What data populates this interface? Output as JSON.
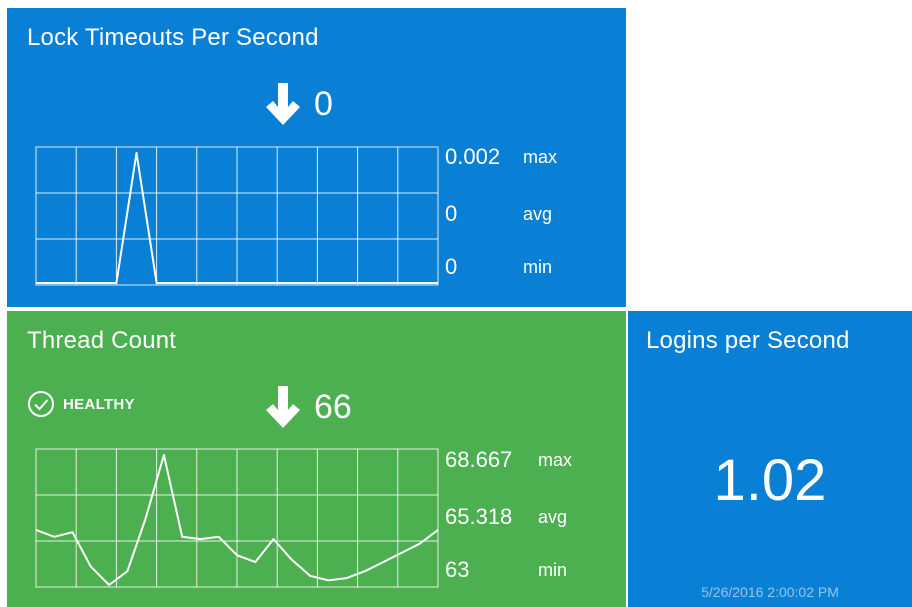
{
  "colors": {
    "blue": "#0a7fd6",
    "green": "#4caf50",
    "white": "#ffffff"
  },
  "lock_tile": {
    "title": "Lock Timeouts Per Second",
    "trend_icon": "arrow-down-icon",
    "current_value": "0",
    "max_value": "0.002",
    "max_label": "max",
    "avg_value": "0",
    "avg_label": "avg",
    "min_value": "0",
    "min_label": "min"
  },
  "thread_tile": {
    "title": "Thread Count",
    "status_icon": "check-circle-icon",
    "status": "HEALTHY",
    "trend_icon": "arrow-down-icon",
    "current_value": "66",
    "max_value": "68.667",
    "max_label": "max",
    "avg_value": "65.318",
    "avg_label": "avg",
    "min_value": "63",
    "min_label": "min"
  },
  "logins_tile": {
    "title": "Logins per Second",
    "value": "1.02",
    "timestamp": "5/26/2016 2:00:02 PM"
  },
  "chart_data": [
    {
      "type": "line",
      "name": "lock-timeouts",
      "ylim": [
        0,
        0.002
      ],
      "grid": true,
      "x": [
        0,
        1,
        2,
        3,
        4,
        5,
        6,
        7,
        8,
        9,
        10,
        11,
        12,
        13,
        14,
        15,
        16,
        17,
        18,
        19,
        20
      ],
      "values": [
        0,
        0,
        0,
        0,
        0,
        0.002,
        0,
        0,
        0,
        0,
        0,
        0,
        0,
        0,
        0,
        0,
        0,
        0,
        0,
        0,
        0
      ]
    },
    {
      "type": "line",
      "name": "thread-count",
      "ylim": [
        63,
        68.667
      ],
      "grid": true,
      "x": [
        0,
        1,
        2,
        3,
        4,
        5,
        6,
        7,
        8,
        9,
        10,
        11,
        12,
        13,
        14,
        15,
        16,
        17,
        18,
        19,
        20,
        21,
        22
      ],
      "values": [
        65.4,
        65.1,
        65.3,
        63.8,
        63.0,
        63.6,
        65.9,
        68.667,
        65.1,
        65.0,
        65.1,
        64.3,
        64.0,
        65.0,
        64.1,
        63.4,
        63.2,
        63.3,
        63.6,
        64.0,
        64.4,
        64.8,
        65.4
      ]
    }
  ]
}
